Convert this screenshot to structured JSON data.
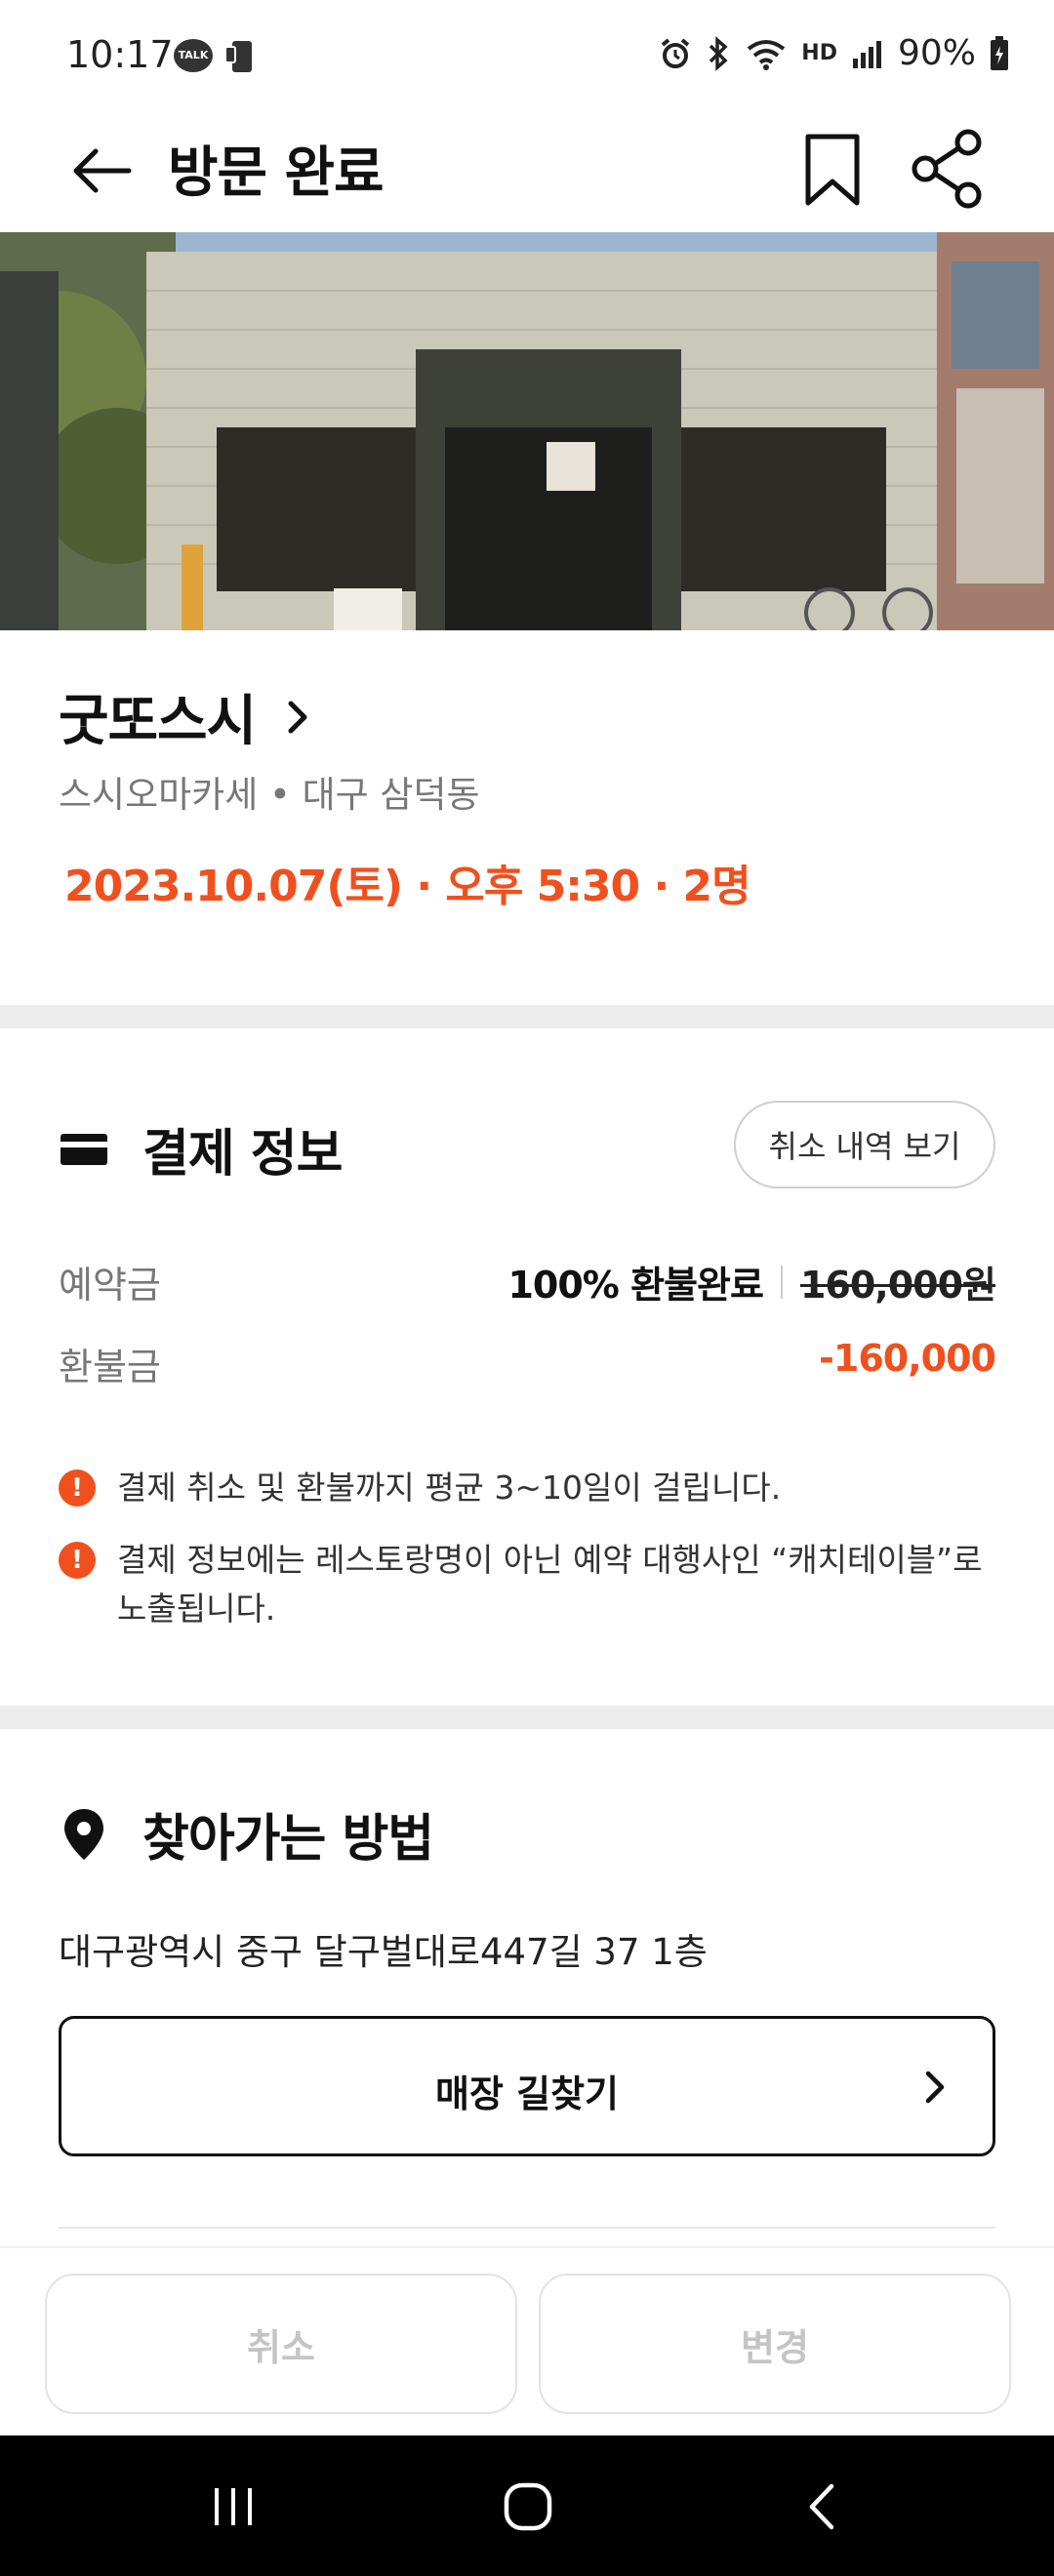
{
  "status_bar": {
    "time": "10:17",
    "talk_badge": "TALK",
    "hd_voice": "HD",
    "battery": "90%"
  },
  "header": {
    "title": "방문 완료"
  },
  "store": {
    "name": "굿또스시",
    "meta": "스시오마카세 • 대구 삼덕동",
    "booking": "2023.10.07(토) · 오후 5:30 · 2명"
  },
  "payment": {
    "title": "결제 정보",
    "history_button": "취소 내역 보기",
    "deposit_label": "예약금",
    "deposit_status": "100% 환불완료",
    "deposit_original": "160,000원",
    "refund_label": "환불금",
    "refund_amount": "-160,000",
    "notices": [
      "결제 취소 및 환불까지 평균 3~10일이 걸립니다.",
      "결제 정보에는 레스토랑명이 아닌 예약 대행사인 “캐치테이블”로 노출됩니다."
    ]
  },
  "directions": {
    "title": "찾아가는 방법",
    "address": "대구광역시 중구 달구벌대로447길 37 1층",
    "button_label": "매장 길찾기"
  },
  "actions": {
    "cancel": "취소",
    "change": "변경"
  },
  "colors": {
    "accent": "#f0501e",
    "divider": "#ececec",
    "disabled_text": "#c4c4c4"
  }
}
